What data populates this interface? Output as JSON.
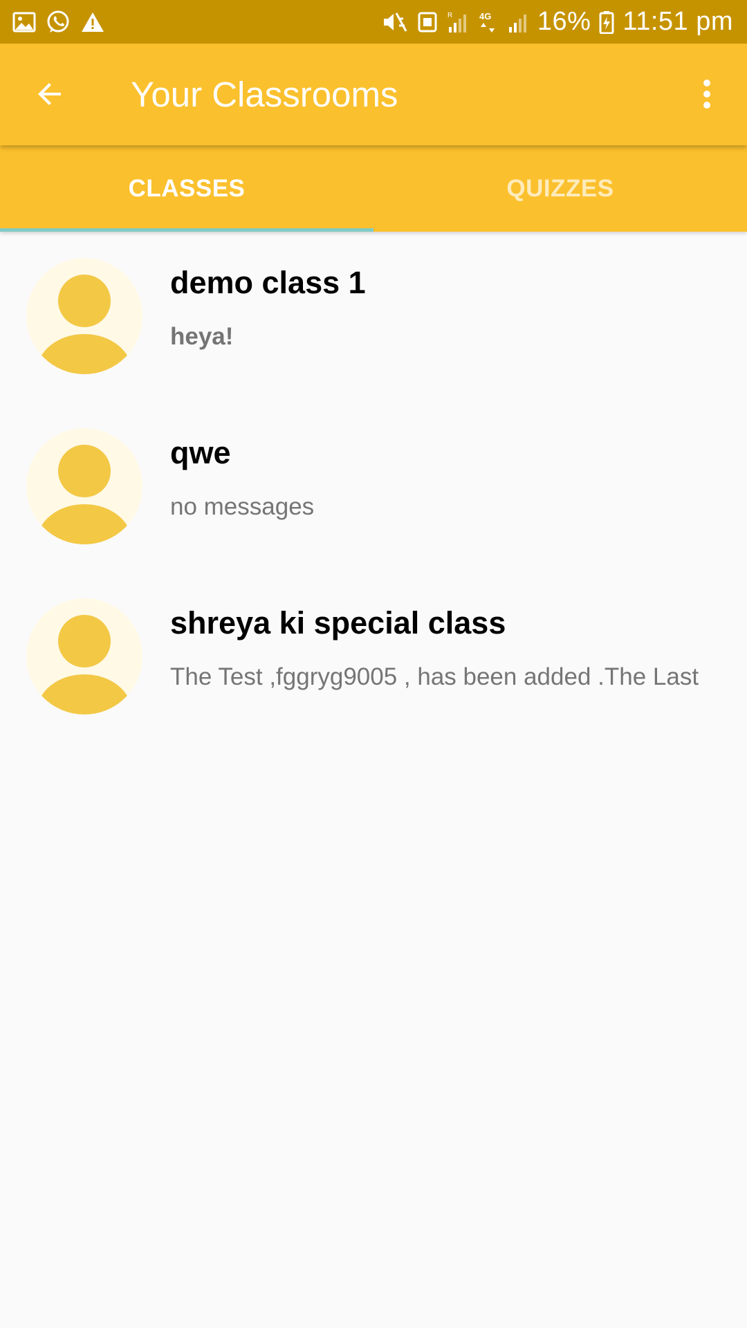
{
  "status_bar": {
    "left_icons": [
      "image-icon",
      "whatsapp-icon",
      "warning-icon"
    ],
    "right_icons": [
      "vibrate-mute-icon",
      "nfc-icon",
      "signal-icon",
      "data-4g-icon",
      "signal-icon",
      "battery-charging-icon"
    ],
    "battery": "16%",
    "time": "11:51 pm"
  },
  "app_bar": {
    "title": "Your Classrooms",
    "back_icon": "arrow-left-icon",
    "menu_icon": "more-vert-icon"
  },
  "tabs": [
    {
      "label": "CLASSES",
      "active": true
    },
    {
      "label": "QUIZZES",
      "active": false
    }
  ],
  "classes": [
    {
      "name": "demo class 1",
      "message": "heya!",
      "unread": true
    },
    {
      "name": "qwe",
      "message": "no messages",
      "unread": false
    },
    {
      "name": "shreya ki special class",
      "message": "The Test ,fggryg9005 , has been added .The Last",
      "unread": false
    }
  ],
  "colors": {
    "primary": "#fbc02d",
    "status_bar": "#c69300",
    "tab_indicator": "#80cbc4",
    "avatar_fill": "#f3c845",
    "avatar_bg": "#fff9e6"
  }
}
